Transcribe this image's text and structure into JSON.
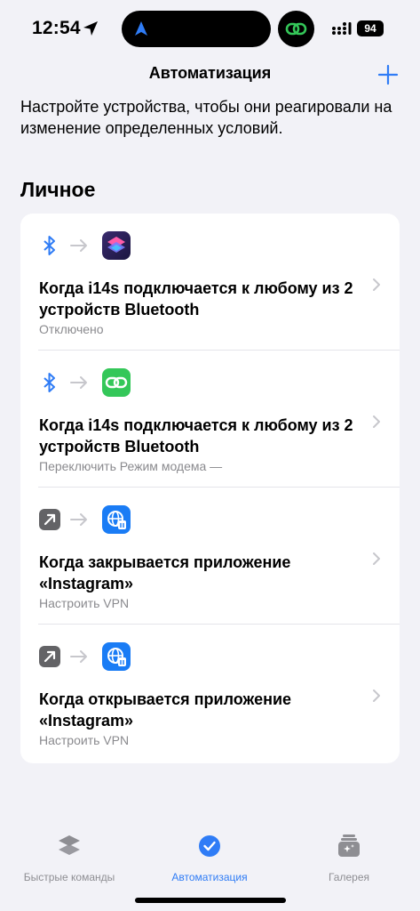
{
  "status_bar": {
    "time": "12:54",
    "battery": "94"
  },
  "nav": {
    "title": "Автоматизация"
  },
  "description": "Настройте устройства, чтобы они реагировали на изменение определенных условий.",
  "section_title": "Личное",
  "automations": [
    {
      "trigger_icon": "bluetooth-icon",
      "action_icon": "shortcuts-icon",
      "title": "Когда i14s подключается к любому из 2 устройств Bluetooth",
      "subtitle": "Отключено"
    },
    {
      "trigger_icon": "bluetooth-icon",
      "action_icon": "personal-hotspot-icon",
      "title": "Когда i14s подключается к любому из 2 устройств Bluetooth",
      "subtitle": "Переключить Режим модема —"
    },
    {
      "trigger_icon": "app-open-arrow-icon",
      "action_icon": "vpn-globe-icon",
      "title": "Когда закрывается приложение «Instagram»",
      "subtitle": "Настроить VPN"
    },
    {
      "trigger_icon": "app-open-arrow-icon",
      "action_icon": "vpn-globe-icon",
      "title": "Когда открывается приложение «Instagram»",
      "subtitle": "Настроить VPN"
    }
  ],
  "tabs": [
    {
      "label": "Быстрые команды",
      "icon": "layers-icon",
      "active": false
    },
    {
      "label": "Автоматизация",
      "icon": "clock-check-icon",
      "active": true
    },
    {
      "label": "Галерея",
      "icon": "gallery-icon",
      "active": false
    }
  ],
  "colors": {
    "accent": "#2f7cf6",
    "background": "#f2f2f7",
    "hotspot_green": "#34c759",
    "secondary_text": "#8a8a8e"
  }
}
